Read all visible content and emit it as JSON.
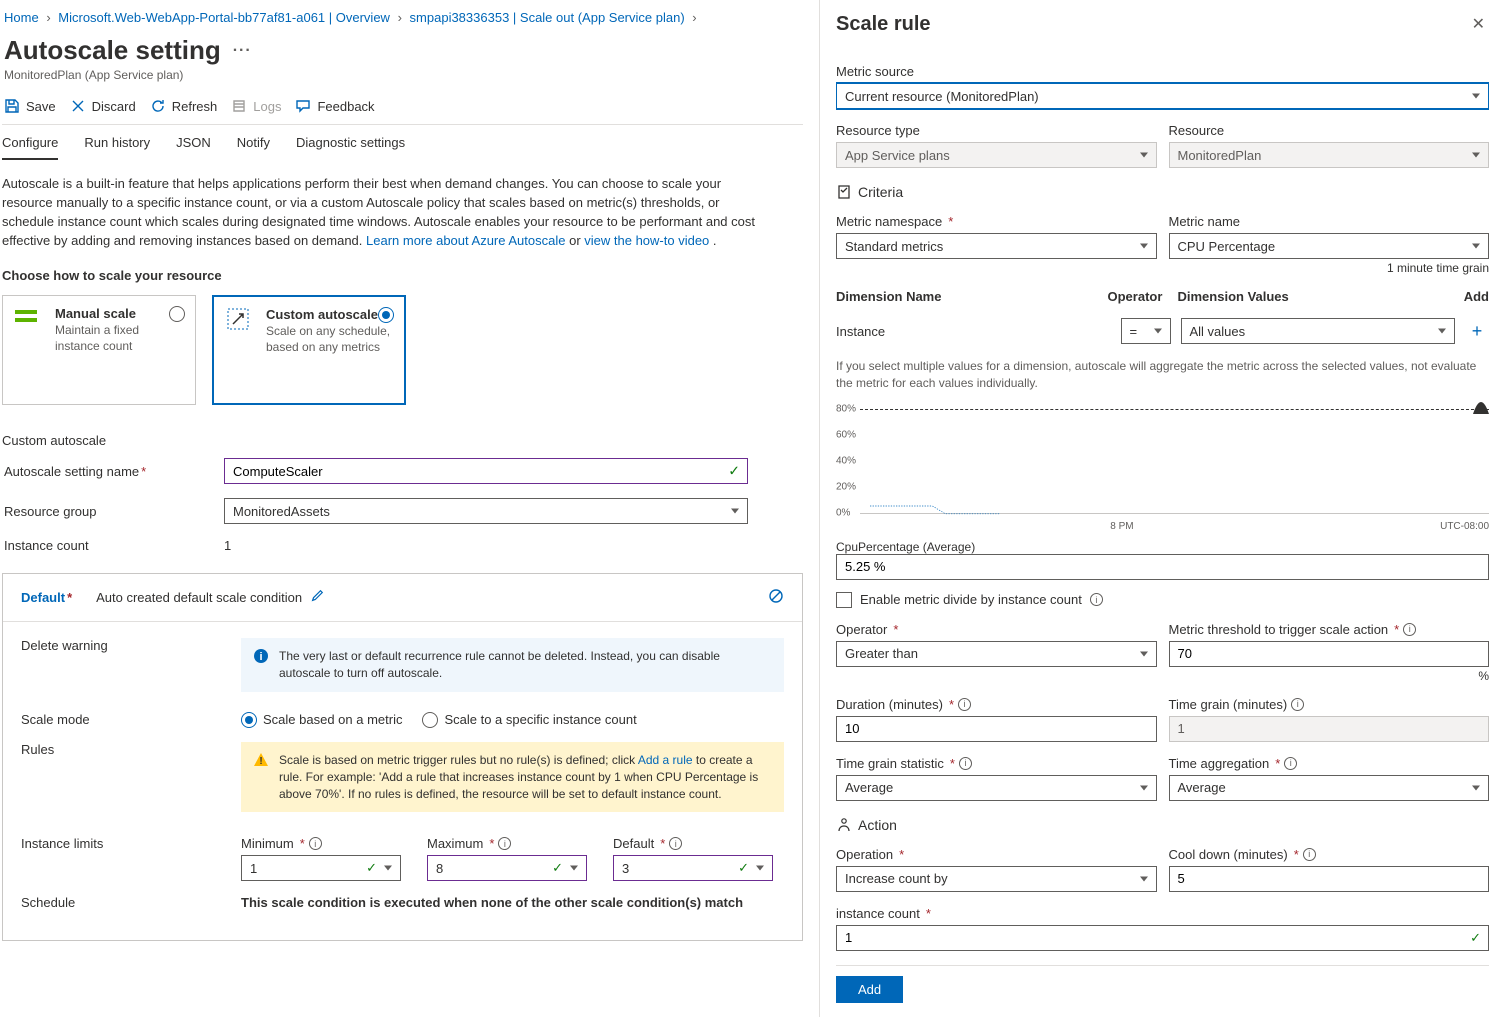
{
  "breadcrumb": [
    {
      "label": "Home"
    },
    {
      "label": "Microsoft.Web-WebApp-Portal-bb77af81-a061 | Overview"
    },
    {
      "label": "smpapi38336353 | Scale out (App Service plan)"
    }
  ],
  "page": {
    "title": "Autoscale setting",
    "subtitle": "MonitoredPlan (App Service plan)"
  },
  "toolbar": {
    "save": "Save",
    "discard": "Discard",
    "refresh": "Refresh",
    "logs": "Logs",
    "feedback": "Feedback"
  },
  "tabs": [
    "Configure",
    "Run history",
    "JSON",
    "Notify",
    "Diagnostic settings"
  ],
  "description": {
    "text": "Autoscale is a built-in feature that helps applications perform their best when demand changes. You can choose to scale your resource manually to a specific instance count, or via a custom Autoscale policy that scales based on metric(s) thresholds, or schedule instance count which scales during designated time windows. Autoscale enables your resource to be performant and cost effective by adding and removing instances based on demand. ",
    "link1": "Learn more about Azure Autoscale",
    "or": " or ",
    "link2": "view the how-to video",
    "dot": "."
  },
  "chooseLabel": "Choose how to scale your resource",
  "cards": {
    "manual": {
      "title": "Manual scale",
      "sub": "Maintain a fixed instance count"
    },
    "custom": {
      "title": "Custom autoscale",
      "sub": "Scale on any schedule, based on any metrics"
    }
  },
  "customHead": "Custom autoscale",
  "form": {
    "nameLbl": "Autoscale setting name",
    "nameVal": "ComputeScaler",
    "rgLbl": "Resource group",
    "rgVal": "MonitoredAssets",
    "instLbl": "Instance count",
    "instVal": "1"
  },
  "cond": {
    "name": "Default",
    "sub": "Auto created default scale condition",
    "deleteLbl": "Delete warning",
    "deleteMsg": "The very last or default recurrence rule cannot be deleted. Instead, you can disable autoscale to turn off autoscale.",
    "modeLbl": "Scale mode",
    "modeA": "Scale based on a metric",
    "modeB": "Scale to a specific instance count",
    "rulesLbl": "Rules",
    "rulesMsg1": "Scale is based on metric trigger rules but no rule(s) is defined; click ",
    "rulesLink": "Add a rule",
    "rulesMsg2": " to create a rule. For example: 'Add a rule that increases instance count by 1 when CPU Percentage is above 70%'. If no rules is defined, the resource will be set to default instance count.",
    "limitsLbl": "Instance limits",
    "min": {
      "lbl": "Minimum",
      "val": "1"
    },
    "max": {
      "lbl": "Maximum",
      "val": "8"
    },
    "def": {
      "lbl": "Default",
      "val": "3"
    },
    "schedLbl": "Schedule",
    "schedNote": "This scale condition is executed when none of the other scale condition(s) match"
  },
  "side": {
    "title": "Scale rule",
    "metricSourceLbl": "Metric source",
    "metricSourceVal": "Current resource (MonitoredPlan)",
    "resTypeLbl": "Resource type",
    "resTypeVal": "App Service plans",
    "resLbl": "Resource",
    "resVal": "MonitoredPlan",
    "criteria": "Criteria",
    "nsLbl": "Metric namespace",
    "nsVal": "Standard metrics",
    "metricNameLbl": "Metric name",
    "metricNameVal": "CPU Percentage",
    "grainNote": "1 minute time grain",
    "dimHead": {
      "name": "Dimension Name",
      "op": "Operator",
      "vals": "Dimension Values",
      "add": "Add"
    },
    "dimRow": {
      "name": "Instance",
      "op": "=",
      "vals": "All values"
    },
    "dimHelper": "If you select multiple values for a dimension, autoscale will aggregate the metric across the selected values, not evaluate the metric for each values individually.",
    "chart": {
      "yticks": [
        "80%",
        "60%",
        "40%",
        "20%",
        "0%"
      ],
      "xtick": "8 PM",
      "tz": "UTC-08:00",
      "metricLabel": "CpuPercentage (Average)",
      "metricVal": "5.25 %"
    },
    "divide": "Enable metric divide by instance count",
    "opLbl": "Operator",
    "opVal": "Greater than",
    "thrLbl": "Metric threshold to trigger scale action",
    "thrVal": "70",
    "pct": "%",
    "durLbl": "Duration (minutes)",
    "durVal": "10",
    "tgLbl": "Time grain (minutes)",
    "tgVal": "1",
    "tgsLbl": "Time grain statistic",
    "tgsVal": "Average",
    "taLbl": "Time aggregation",
    "taVal": "Average",
    "action": "Action",
    "operLbl": "Operation",
    "operVal": "Increase count by",
    "coolLbl": "Cool down (minutes)",
    "coolVal": "5",
    "icLbl": "instance count",
    "icVal": "1",
    "addBtn": "Add"
  }
}
